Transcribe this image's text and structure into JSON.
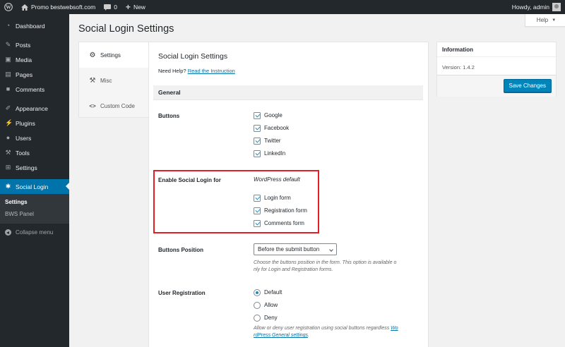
{
  "adminbar": {
    "site_name": "Promo bestwebsoft.com",
    "comments_count": "0",
    "new_label": "New",
    "greeting": "Howdy, admin"
  },
  "sidebar": {
    "items": [
      {
        "label": "Dashboard",
        "icon": "dashboard-icon"
      },
      {
        "label": "Posts",
        "icon": "pin-icon"
      },
      {
        "label": "Media",
        "icon": "media-icon"
      },
      {
        "label": "Pages",
        "icon": "pages-icon"
      },
      {
        "label": "Comments",
        "icon": "comment-icon"
      },
      {
        "label": "Appearance",
        "icon": "brush-icon"
      },
      {
        "label": "Plugins",
        "icon": "plugin-icon"
      },
      {
        "label": "Users",
        "icon": "users-icon"
      },
      {
        "label": "Tools",
        "icon": "wrench-icon"
      },
      {
        "label": "Settings",
        "icon": "settings-icon"
      },
      {
        "label": "Social Login",
        "icon": "asterisk-icon"
      }
    ],
    "submenu": [
      "Settings",
      "BWS Panel"
    ],
    "collapse_label": "Collapse menu"
  },
  "help_tab": "Help",
  "page_title": "Social Login Settings",
  "tabs": [
    "Settings",
    "Misc",
    "Custom Code"
  ],
  "panel": {
    "title": "Social Login Settings",
    "need_help": "Need Help?",
    "instruction_link": "Read the Instruction",
    "section": "General",
    "buttons_label": "Buttons",
    "buttons": [
      "Google",
      "Facebook",
      "Twitter",
      "LinkedIn"
    ],
    "enable_label": "Enable Social Login for",
    "wordpress_default": "WordPress default",
    "forms": [
      "Login form",
      "Registration form",
      "Comments form"
    ],
    "position_label": "Buttons Position",
    "position_value": "Before the submit button",
    "position_note_1": "Choose the buttons position in the form. This option is available o",
    "position_note_2": "nly for Login and Registration forms.",
    "registration_label": "User Registration",
    "registration_options": [
      "Default",
      "Allow",
      "Deny"
    ],
    "registration_selected": "Default",
    "registration_note_1": "Allow or deny user registration using social buttons regardless ",
    "registration_note_link_1": "Wo",
    "registration_note_link_2": "rdPress General settings",
    "registration_note_end": "."
  },
  "info": {
    "title": "Information",
    "version": "Version: 1.4.2",
    "save_label": "Save Changes"
  },
  "colors": {
    "accent": "#0073aa",
    "highlight_border": "#e31e24",
    "sidebar_bg": "#23282d"
  }
}
